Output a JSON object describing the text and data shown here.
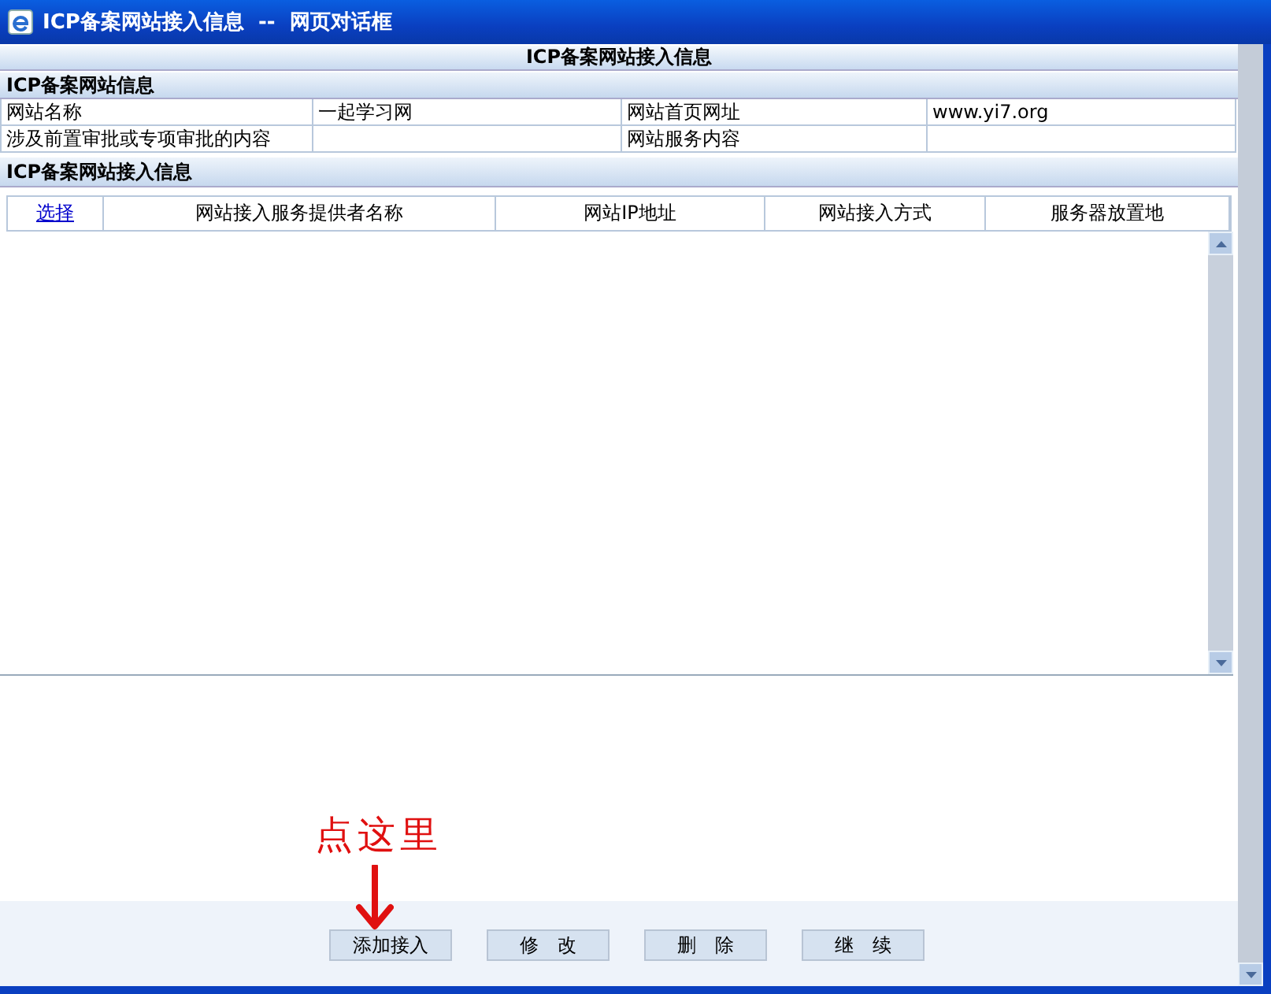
{
  "window": {
    "title": "ICP备案网站接入信息  --  网页对话框"
  },
  "page_title": "ICP备案网站接入信息",
  "site_info": {
    "title": "ICP备案网站信息",
    "fields": [
      {
        "label": "网站名称",
        "value": "一起学习网"
      },
      {
        "label": "网站首页网址",
        "value": "www.yi7.org"
      },
      {
        "label": "涉及前置审批或专项审批的内容"
      },
      {
        "label": "网站服务内容"
      }
    ]
  },
  "access_info": {
    "title": "ICP备案网站接入信息",
    "columns": [
      {
        "label": "选择",
        "kind": "link"
      },
      {
        "label": "网站接入服务提供者名称",
        "kind": "text"
      },
      {
        "label": "网站IP地址",
        "kind": "text"
      },
      {
        "label": "网站接入方式",
        "kind": "text"
      },
      {
        "label": "服务器放置地",
        "kind": "text"
      }
    ]
  },
  "annotation": "点这里",
  "buttons": [
    "添加接入",
    "修　改",
    "删　除",
    "继　续"
  ]
}
